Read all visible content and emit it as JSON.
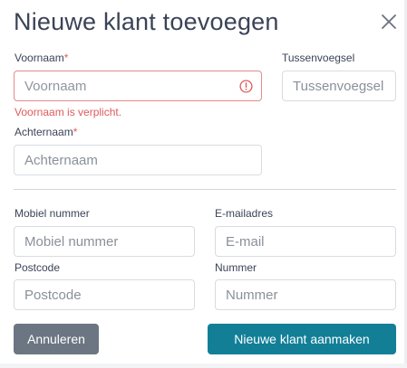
{
  "dialog": {
    "title": "Nieuwe klant toevoegen"
  },
  "fields": {
    "voornaam": {
      "label": "Voornaam",
      "required_marker": "*",
      "placeholder": "Voornaam",
      "value": "",
      "error": "Voornaam is verplicht."
    },
    "tussenvoegsel": {
      "label": "Tussenvoegsel",
      "placeholder": "Tussenvoegsel",
      "value": ""
    },
    "achternaam": {
      "label": "Achternaam",
      "required_marker": "*",
      "placeholder": "Achternaam",
      "value": ""
    },
    "mobiel": {
      "label": "Mobiel nummer",
      "placeholder": "Mobiel nummer",
      "value": ""
    },
    "email": {
      "label": "E-mailadres",
      "placeholder": "E-mail",
      "value": ""
    },
    "postcode": {
      "label": "Postcode",
      "placeholder": "Postcode",
      "value": ""
    },
    "nummer": {
      "label": "Nummer",
      "placeholder": "Nummer",
      "value": ""
    }
  },
  "buttons": {
    "cancel": "Annuleren",
    "submit": "Nieuwe klant aanmaken"
  },
  "icons": {
    "close": "close-icon",
    "error": "error-circle-icon"
  },
  "colors": {
    "primary": "#127f97",
    "secondary": "#6c7683",
    "error": "#e05a5a"
  }
}
